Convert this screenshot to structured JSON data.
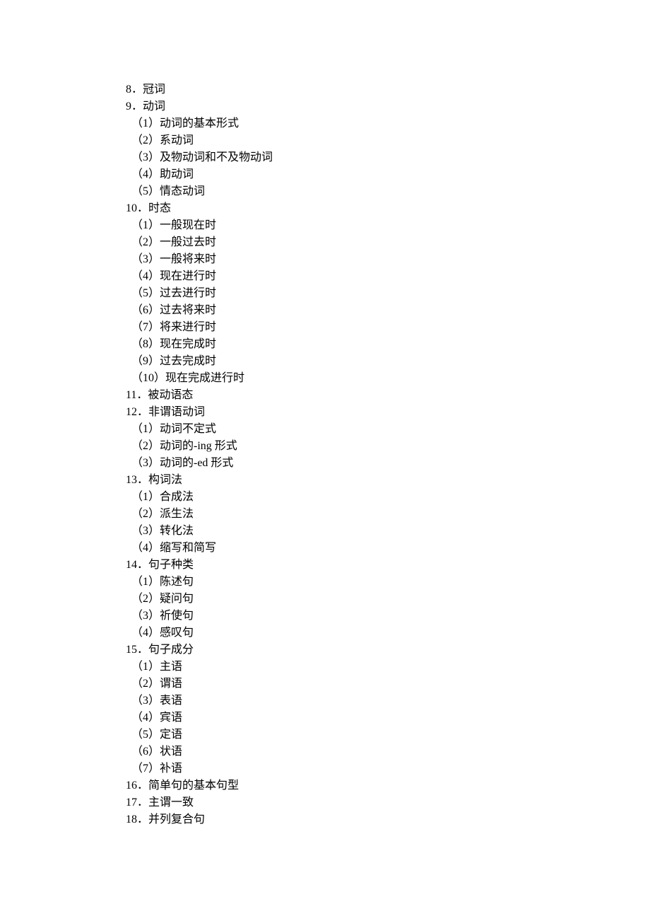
{
  "items": [
    {
      "level": 0,
      "text": "8．冠词"
    },
    {
      "level": 0,
      "text": "9．动词"
    },
    {
      "level": 1,
      "text": "（1）动词的基本形式"
    },
    {
      "level": 1,
      "text": "（2）系动词"
    },
    {
      "level": 1,
      "text": "（3）及物动词和不及物动词"
    },
    {
      "level": 1,
      "text": "（4）助动词"
    },
    {
      "level": 1,
      "text": "（5）情态动词"
    },
    {
      "level": 0,
      "text": "10．时态"
    },
    {
      "level": 1,
      "text": "（1）一般现在时"
    },
    {
      "level": 1,
      "text": "（2）一般过去时"
    },
    {
      "level": 1,
      "text": "（3）一般将来时"
    },
    {
      "level": 1,
      "text": "（4）现在进行时"
    },
    {
      "level": 1,
      "text": "（5）过去进行时"
    },
    {
      "level": 1,
      "text": "（6）过去将来时"
    },
    {
      "level": 1,
      "text": "（7）将来进行时"
    },
    {
      "level": 1,
      "text": "（8）现在完成时"
    },
    {
      "level": 1,
      "text": "（9）过去完成时"
    },
    {
      "level": 1,
      "text": "（10）现在完成进行时"
    },
    {
      "level": 0,
      "text": "11．被动语态"
    },
    {
      "level": 0,
      "text": "12．非谓语动词"
    },
    {
      "level": 1,
      "text": "（1）动词不定式"
    },
    {
      "level": 1,
      "text": "（2）动词的-ing 形式"
    },
    {
      "level": 1,
      "text": "（3）动词的-ed 形式"
    },
    {
      "level": 0,
      "text": "13．构词法"
    },
    {
      "level": 1,
      "text": "（1）合成法"
    },
    {
      "level": 1,
      "text": "（2）派生法"
    },
    {
      "level": 1,
      "text": "（3）转化法"
    },
    {
      "level": 1,
      "text": "（4）缩写和简写"
    },
    {
      "level": 0,
      "text": "14．句子种类"
    },
    {
      "level": 1,
      "text": "（1）陈述句"
    },
    {
      "level": 1,
      "text": "（2）疑问句"
    },
    {
      "level": 1,
      "text": "（3）祈使句"
    },
    {
      "level": 1,
      "text": "（4）感叹句"
    },
    {
      "level": 0,
      "text": "15．句子成分"
    },
    {
      "level": 1,
      "text": "（1）主语"
    },
    {
      "level": 1,
      "text": "（2）谓语"
    },
    {
      "level": 1,
      "text": "（3）表语"
    },
    {
      "level": 1,
      "text": "（4）宾语"
    },
    {
      "level": 1,
      "text": "（5）定语"
    },
    {
      "level": 1,
      "text": "（6）状语"
    },
    {
      "level": 1,
      "text": "（7）补语"
    },
    {
      "level": 0,
      "text": "16．简单句的基本句型"
    },
    {
      "level": 0,
      "text": "17．主谓一致"
    },
    {
      "level": 0,
      "text": "18．并列复合句"
    }
  ]
}
